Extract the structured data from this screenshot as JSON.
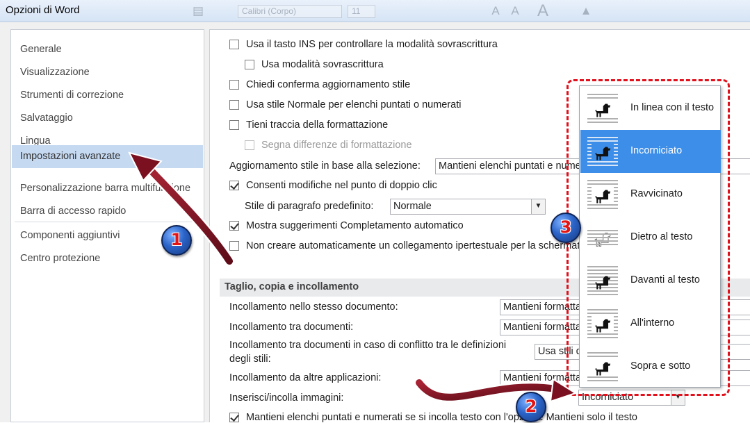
{
  "window": {
    "title": "Opzioni di Word"
  },
  "background_toolbar": {
    "font_name": "Calibri (Corpo)",
    "font_size": "11"
  },
  "nav": {
    "items": [
      {
        "label": "Generale"
      },
      {
        "label": "Visualizzazione"
      },
      {
        "label": "Strumenti di correzione"
      },
      {
        "label": "Salvataggio"
      },
      {
        "label": "Lingua"
      },
      {
        "label": "Impostazioni avanzate",
        "selected": true
      },
      {
        "label": "Personalizzazione barra multifunzione"
      },
      {
        "label": "Barra di accesso rapido"
      },
      {
        "label": "Componenti aggiuntivi"
      },
      {
        "label": "Centro protezione"
      }
    ]
  },
  "options": {
    "ins_key": {
      "label": "Usa il tasto INS per controllare la modalità sovrascrittura",
      "checked": false
    },
    "overtype": {
      "label": "Usa modalità sovrascrittura",
      "checked": false
    },
    "confirm_style": {
      "label": "Chiedi conferma aggiornamento stile",
      "checked": false
    },
    "normal_style_lists": {
      "label": "Usa stile Normale per elenchi puntati o numerati",
      "checked": false
    },
    "track_formatting": {
      "label": "Tieni traccia della formattazione",
      "checked": false
    },
    "mark_inconsistencies": {
      "label": "Segna differenze di formattazione",
      "checked": false,
      "disabled": true
    },
    "style_update": {
      "label": "Aggiornamento stile in base alla selezione:",
      "value": "Mantieni elenchi puntati e numerati"
    },
    "click_and_type": {
      "label": "Consenti modifiche nel punto di doppio clic",
      "checked": true
    },
    "default_paragraph_style": {
      "label": "Stile di paragrafo predefinito:",
      "value": "Normale"
    },
    "autocomplete": {
      "label": "Mostra suggerimenti Completamento automatico",
      "checked": true
    },
    "no_hyperlink": {
      "label": "Non creare automaticamente un collegamento ipertestuale per la schermata",
      "checked": false
    }
  },
  "section_cut_copy_paste": {
    "header": "Taglio, copia e incollamento",
    "rows": [
      {
        "label": "Incollamento nello stesso documento:",
        "value": "Mantieni formattazione originale (predefinita)"
      },
      {
        "label": "Incollamento tra documenti:",
        "value": "Mantieni formattazione originale (predefinita)"
      },
      {
        "label_line1": "Incollamento tra documenti in caso di conflitto tra le definizioni",
        "label_line2": "degli stili:",
        "value": "Usa stili di destinazione (predefinita)"
      },
      {
        "label": "Incollamento da altre applicazioni:",
        "value": "Mantieni formattazione originale (predefinita)"
      },
      {
        "label": "Inserisci/incolla immagini:",
        "value": "Incorniciato"
      }
    ],
    "keep_bullets": {
      "label": "Mantieni elenchi puntati e numerati se si incolla testo con l'opzione Mantieni solo il testo",
      "checked": true
    }
  },
  "wrap_menu": {
    "selected": "Incorniciato",
    "items": [
      {
        "label": "In linea con il testo",
        "icon": "inline-wrap-icon"
      },
      {
        "label": "Incorniciato",
        "icon": "square-wrap-icon"
      },
      {
        "label": "Ravvicinato",
        "icon": "tight-wrap-icon"
      },
      {
        "label": "Dietro al testo",
        "icon": "behind-text-icon"
      },
      {
        "label": "Davanti al testo",
        "icon": "in-front-text-icon"
      },
      {
        "label": "All'interno",
        "icon": "through-wrap-icon"
      },
      {
        "label": "Sopra e sotto",
        "icon": "top-bottom-wrap-icon"
      }
    ]
  },
  "callouts": [
    {
      "number": "1"
    },
    {
      "number": "2"
    },
    {
      "number": "3"
    }
  ],
  "colors": {
    "nav_selected": "#c5d9f1",
    "menu_selected": "#3d8ee8",
    "callout_border": "#e0101c",
    "arrow": "#7a1020"
  }
}
